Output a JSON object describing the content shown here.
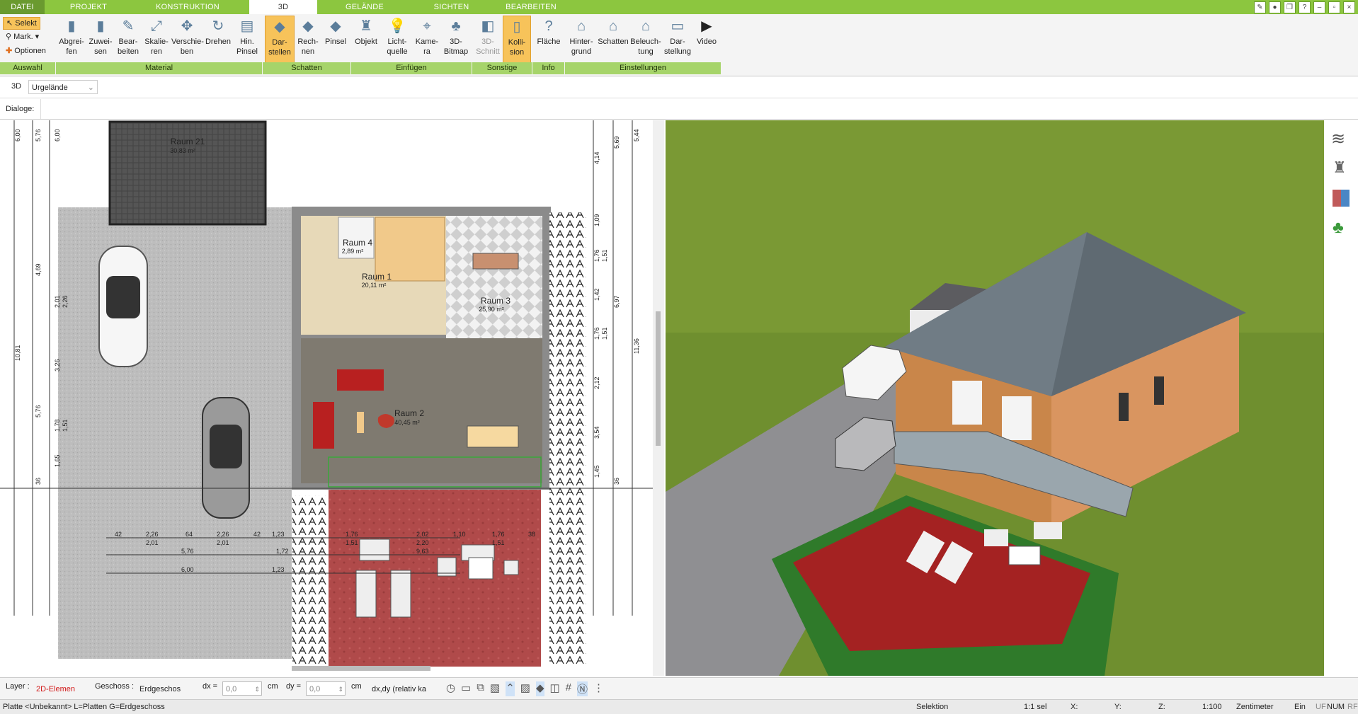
{
  "tabs": {
    "file": "DATEI",
    "items": [
      "PROJEKT",
      "KONSTRUKTION",
      "3D",
      "GELÄNDE",
      "SICHTEN",
      "BEARBEITEN"
    ],
    "active": "3D"
  },
  "ribbon": {
    "auswahl": {
      "select": "Selekt",
      "mark": "Mark.",
      "options": "Optionen"
    },
    "buttons": [
      {
        "l1": "Abgrei-",
        "l2": "fen"
      },
      {
        "l1": "Zuwei-",
        "l2": "sen"
      },
      {
        "l1": "Bear-",
        "l2": "beiten"
      },
      {
        "l1": "Skalie-",
        "l2": "ren"
      },
      {
        "l1": "Verschie-",
        "l2": "ben"
      },
      {
        "l1": "Drehen",
        "l2": ""
      },
      {
        "l1": "Hin.",
        "l2": "Pinsel"
      },
      {
        "l1": "Dar-",
        "l2": "stellen"
      },
      {
        "l1": "Rech-",
        "l2": "nen"
      },
      {
        "l1": "Pinsel",
        "l2": ""
      },
      {
        "l1": "Objekt",
        "l2": ""
      },
      {
        "l1": "Licht-",
        "l2": "quelle"
      },
      {
        "l1": "Kame-",
        "l2": "ra"
      },
      {
        "l1": "3D-",
        "l2": "Bitmap"
      },
      {
        "l1": "3D-",
        "l2": "Schnitt"
      },
      {
        "l1": "Kolli-",
        "l2": "sion"
      },
      {
        "l1": "Fläche",
        "l2": ""
      },
      {
        "l1": "Hinter-",
        "l2": "grund"
      },
      {
        "l1": "Schatten",
        "l2": ""
      },
      {
        "l1": "Beleuch-",
        "l2": "tung"
      },
      {
        "l1": "Dar-",
        "l2": "stellung"
      },
      {
        "l1": "Video",
        "l2": ""
      }
    ],
    "groups": [
      "Auswahl",
      "Material",
      "Schatten",
      "Einfügen",
      "Sonstige",
      "Info",
      "Einstellungen"
    ]
  },
  "view_selector": {
    "mode": "3D",
    "terrain": "Urgelände"
  },
  "dialogs_label": "Dialoge:",
  "plan": {
    "rooms": [
      {
        "name": "Raum 21",
        "area": "30,83 m²"
      },
      {
        "name": "Raum 4",
        "area": "2,89 m²"
      },
      {
        "name": "Raum 1",
        "area": "20,11 m²"
      },
      {
        "name": "Raum 3",
        "area": "25,90 m²"
      },
      {
        "name": "Raum 2",
        "area": "40,45 m²"
      }
    ],
    "dims_left": [
      "6,00",
      "5,76",
      "6,00",
      "4,69",
      "2,01",
      "2,26",
      "10,81",
      "3,26",
      "5,76",
      "1,78",
      "1,51",
      "1,65",
      "36"
    ],
    "dims_right": [
      "4,14",
      "5,69",
      "5,44",
      "1,09",
      "1,76",
      "1,51",
      "1,42",
      "6,97",
      "1,76",
      "1,51",
      "11,36",
      "2,12",
      "3,54",
      "1,45",
      "36"
    ],
    "dims_bottom": [
      "42",
      "2,26",
      "64",
      "2,26",
      "42",
      "1,23",
      "2,01",
      "2,01",
      "5,76",
      "1,72",
      "6,00",
      "1,23",
      "1,76",
      "1,51",
      "2,02",
      "2,20",
      "9,63",
      "1,76",
      "1,51",
      "1,10",
      "38"
    ]
  },
  "toolbar": {
    "layer_label": "Layer :",
    "layer_value": "2D-Elemen",
    "floor_label": "Geschoss :",
    "floor_value": "Erdgeschos",
    "dx_label": "dx =",
    "dx_value": "0,0",
    "dx_unit": "cm",
    "dy_label": "dy =",
    "dy_value": "0,0",
    "dy_unit": "cm",
    "mode_value": "dx,dy (relativ ka"
  },
  "statusbar": {
    "left": "Platte <Unbekannt> L=Platten G=Erdgeschoss",
    "selection": "Selektion",
    "count": "1:1 sel",
    "x": "X:",
    "y": "Y:",
    "z": "Z:",
    "scale": "1:100",
    "unit": "Zentimeter",
    "snap": "Ein",
    "flags": [
      "UF",
      "NUM",
      "RF"
    ]
  },
  "colors": {
    "accent_green": "#8cc63f",
    "group_green": "#a6d46a",
    "active_button": "#f7c35a"
  }
}
